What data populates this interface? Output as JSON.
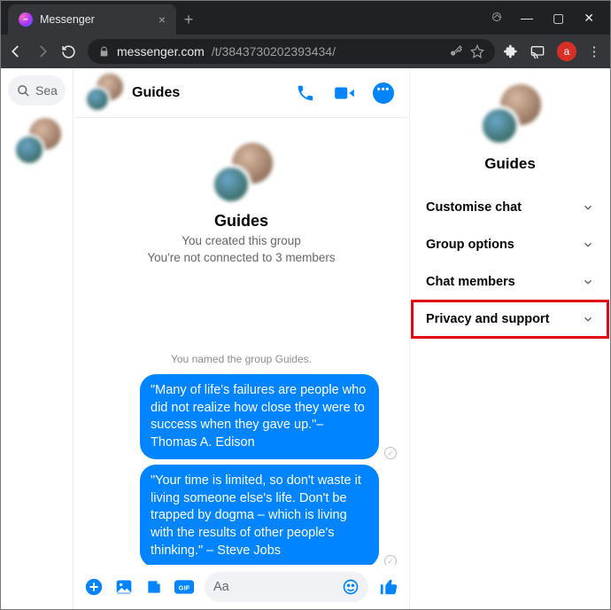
{
  "browser": {
    "tab_title": "Messenger",
    "url_domain": "messenger.com",
    "url_path": "/t/3843730202393434/",
    "profile_initial": "a"
  },
  "sidebar": {
    "search_placeholder": "Sea"
  },
  "chat": {
    "header_title": "Guides",
    "intro_title": "Guides",
    "intro_line1": "You created this group",
    "intro_line2": "You're not connected to 3 members",
    "system_label": "You named the group Guides.",
    "messages": [
      {
        "text": "\"Many of life's failures are people who did not realize how close they were to success when they gave up.\"– Thomas A. Edison"
      },
      {
        "text": "\"Your time is limited, so don't waste it living someone else's life. Don't be trapped by dogma – which is living with the results of other people's thinking.\" – Steve Jobs"
      }
    ],
    "composer_placeholder": "Aa"
  },
  "info": {
    "title": "Guides",
    "sections": [
      {
        "label": "Customise chat"
      },
      {
        "label": "Group options"
      },
      {
        "label": "Chat members"
      },
      {
        "label": "Privacy and support",
        "highlighted": true
      }
    ]
  }
}
